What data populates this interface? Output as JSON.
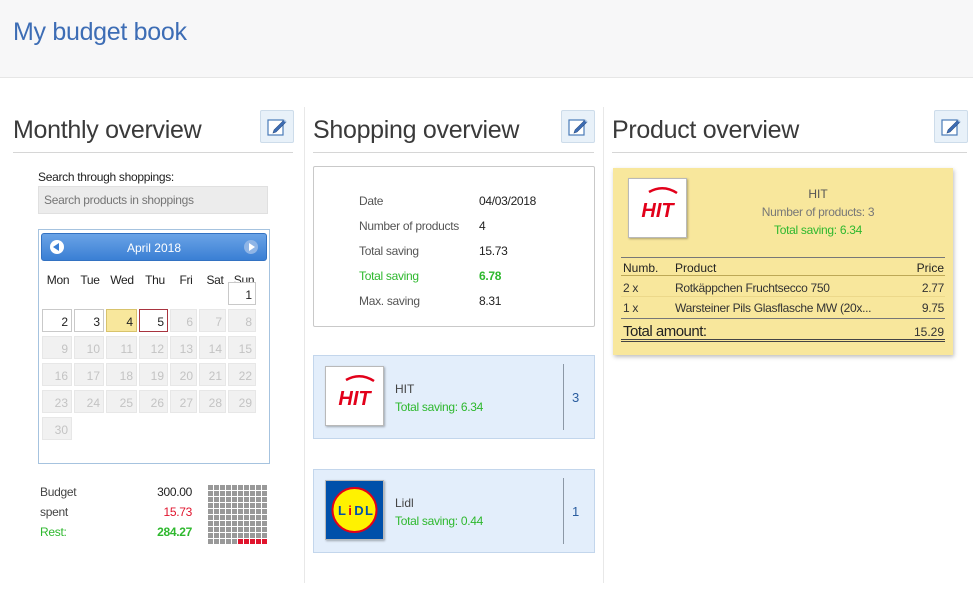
{
  "app": {
    "title": "My budget book"
  },
  "monthly": {
    "title": "Monthly overview",
    "edit_icon": "edit-icon",
    "search": {
      "label": "Search through shoppings:",
      "placeholder": "Search products in shoppings",
      "value": ""
    },
    "calendar": {
      "month_label": "April 2018",
      "weekdays": [
        "Mon",
        "Tue",
        "Wed",
        "Thu",
        "Fri",
        "Sat",
        "Sun"
      ],
      "days": [
        "1",
        "2",
        "3",
        "4",
        "5",
        "6",
        "7",
        "8",
        "9",
        "10",
        "11",
        "12",
        "13",
        "14",
        "15",
        "16",
        "17",
        "18",
        "19",
        "20",
        "21",
        "22",
        "23",
        "24",
        "25",
        "26",
        "27",
        "28",
        "29",
        "30"
      ]
    },
    "budget": {
      "budget_label": "Budget",
      "budget_value": "300.00",
      "spent_label": "spent",
      "spent_value": "15.73",
      "rest_label": "Rest:",
      "rest_value": "284.27",
      "spent_fraction": 0.0524
    }
  },
  "shopping": {
    "title": "Shopping overview",
    "edit_icon": "edit-icon",
    "details": {
      "date_label": "Date",
      "date_value": "04/03/2018",
      "num_label": "Number of products",
      "num_value": "4",
      "total_label": "Total saving",
      "total_value": "15.73",
      "total2_label": "Total saving",
      "total2_value": "6.78",
      "max_label": "Max. saving",
      "max_value": "8.31"
    },
    "shops": [
      {
        "name": "HIT",
        "saving": "Total saving: 6.34",
        "count": "3",
        "logo": "hit-logo"
      },
      {
        "name": "Lidl",
        "saving": "Total saving: 0.44",
        "count": "1",
        "logo": "lidl-logo"
      }
    ]
  },
  "product": {
    "title": "Product overview",
    "edit_icon": "edit-icon",
    "shop_name": "HIT",
    "count_text": "Number of products: 3",
    "saving_text": "Total saving: 6.34",
    "logo_text": "HIT",
    "headers": {
      "num": "Numb.",
      "product": "Product",
      "price": "Price"
    },
    "rows": [
      {
        "num": "2 x",
        "product": "Rotkäppchen Fruchtsecco 750",
        "price": "2.77"
      },
      {
        "num": "1 x",
        "product": "Warsteiner Pils Glasflasche MW (20x...",
        "price": "9.75"
      }
    ],
    "total_label": "Total amount:",
    "total_value": "15.29"
  },
  "logos": {
    "hit": "HIT",
    "lidl_letters": [
      "L",
      "i",
      "D",
      "L"
    ]
  },
  "colors": {
    "accent": "#3d6db5",
    "saving_green": "#2eb82e",
    "spent_red": "#e0142d",
    "highlight_yellow": "#f8e79c",
    "card_blue": "#e3eefb"
  }
}
